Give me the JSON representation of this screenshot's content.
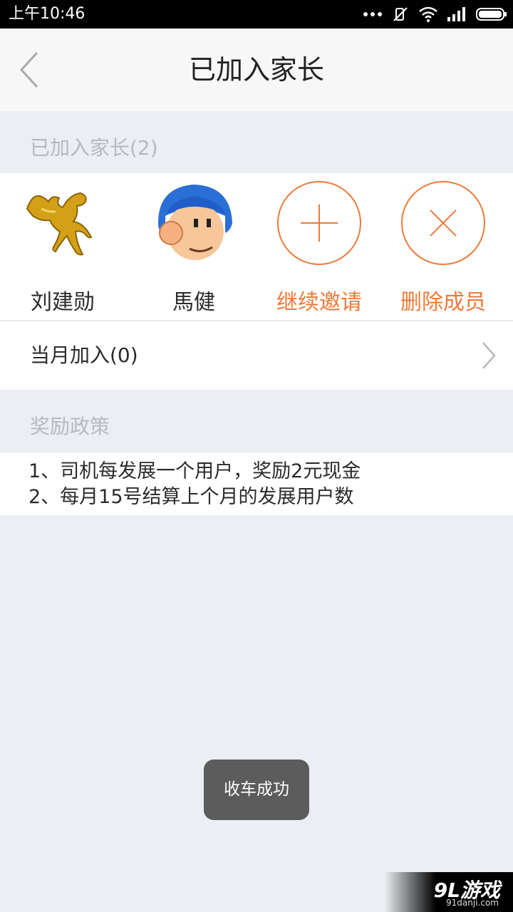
{
  "status_bar": {
    "time": "上午10:46",
    "icons": [
      "more-dots-icon",
      "mute-icon",
      "wifi-icon",
      "signal-icon",
      "battery-icon"
    ]
  },
  "header": {
    "title": "已加入家长",
    "back_icon": "chevron-left-icon"
  },
  "joined_section": {
    "label": "已加入家长(2)"
  },
  "members": [
    {
      "name": "刘建勋",
      "icon": "pegasus-avatar"
    },
    {
      "name": "馬健",
      "icon": "cartoon-boy-avatar"
    },
    {
      "name": "继续邀请",
      "icon": "plus-circle-icon"
    },
    {
      "name": "删除成员",
      "icon": "x-circle-icon"
    }
  ],
  "monthly_row": {
    "label": "当月加入(0)",
    "icon": "chevron-right-icon"
  },
  "policy_section": {
    "label": "奖励政策"
  },
  "policy_lines": [
    "1、司机每发展一个用户，奖励2元现金",
    "2、每月15号结算上个月的发展用户数"
  ],
  "toast": {
    "text": "收车成功"
  },
  "watermark": {
    "brand": "9L游戏",
    "url": "91danji.com"
  },
  "colors": {
    "accent": "#ee7a3b",
    "background": "#ebeef2",
    "toast": "#5c5c5c"
  }
}
